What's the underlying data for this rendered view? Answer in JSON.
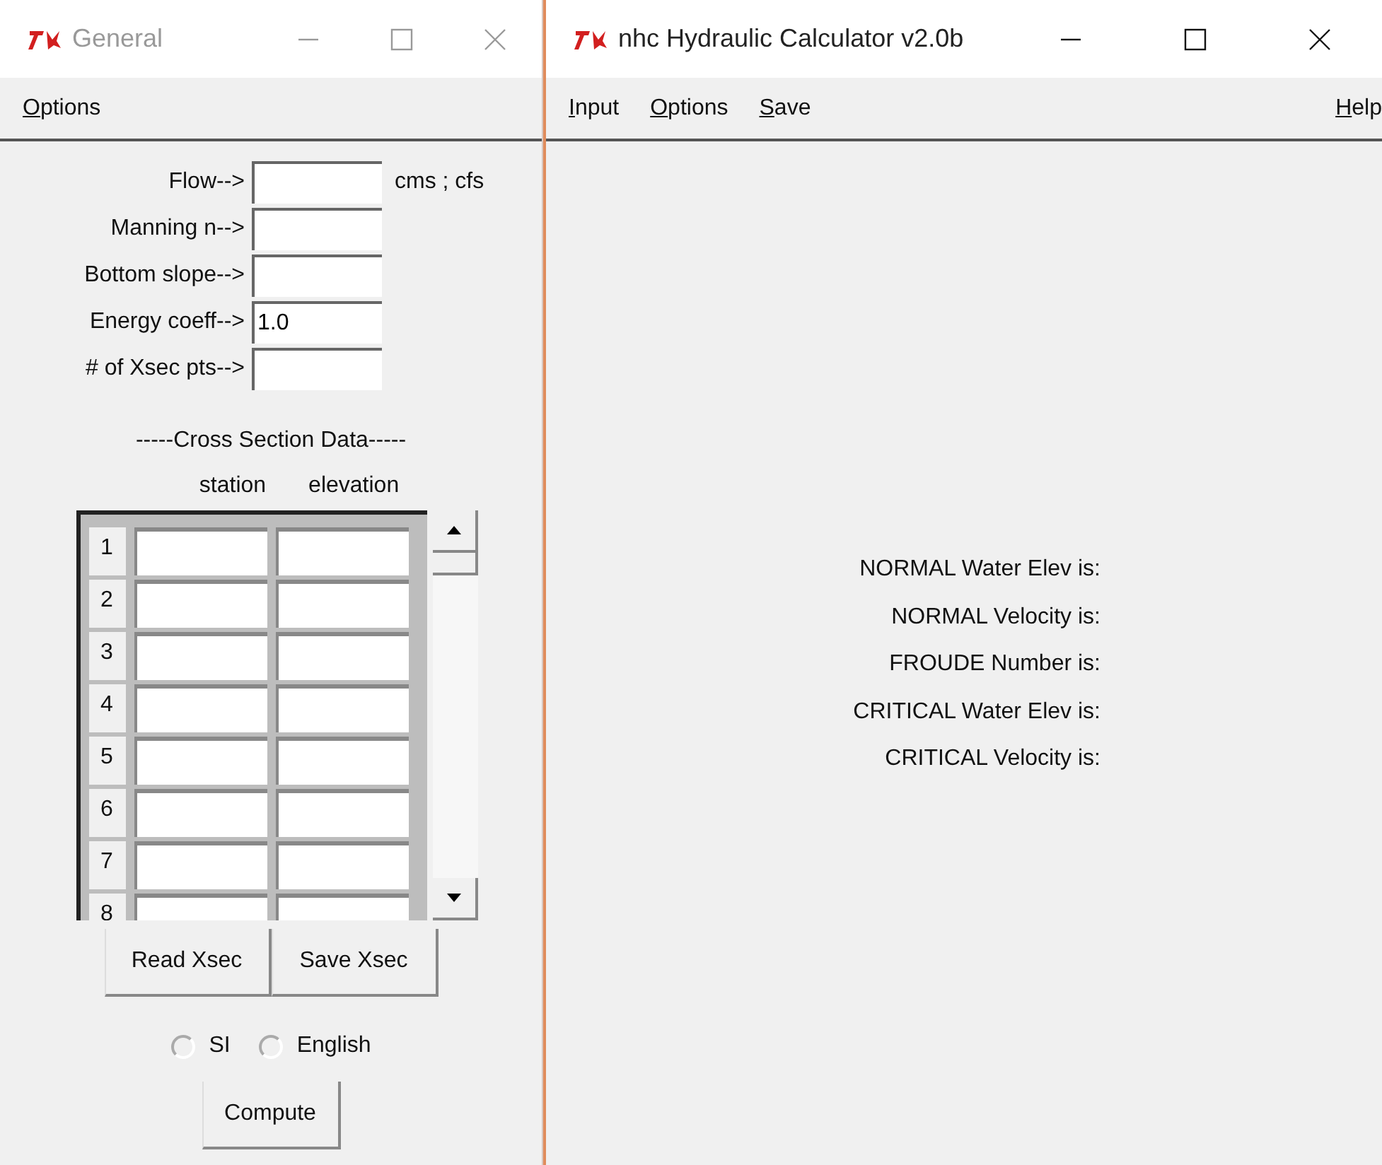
{
  "windows": [
    {
      "title": "General",
      "active": false,
      "menu": [
        "Options"
      ],
      "fields": [
        {
          "label": "Flow-->",
          "unit": "cms ; cfs"
        },
        {
          "label": "Manning n-->"
        },
        {
          "label": "Bottom slope-->"
        },
        {
          "label": "Energy coeff-->",
          "value": "1.0"
        },
        {
          "label": "# of Xsec pts-->"
        }
      ],
      "section_title": "-----Cross Section Data-----",
      "table": {
        "columns": [
          "station",
          "elevation"
        ],
        "rows": [
          "1",
          "2",
          "3",
          "4",
          "5",
          "6",
          "7",
          "8"
        ]
      },
      "xsec_buttons": [
        "Read Xsec",
        "Save Xsec"
      ],
      "units": [
        {
          "label": "SI",
          "selected": false
        },
        {
          "label": "English",
          "selected": false
        }
      ],
      "compute_button": "Compute"
    },
    {
      "title": "nhc Hydraulic Calculator v2.0b",
      "active": true,
      "menu": [
        "Input",
        "Options",
        "Save"
      ],
      "help_menu": "Help",
      "results": [
        "NORMAL Water Elev is:",
        "NORMAL Velocity is:",
        "FROUDE Number is:",
        "CRITICAL Water Elev is:",
        "CRITICAL Velocity is:"
      ]
    }
  ]
}
